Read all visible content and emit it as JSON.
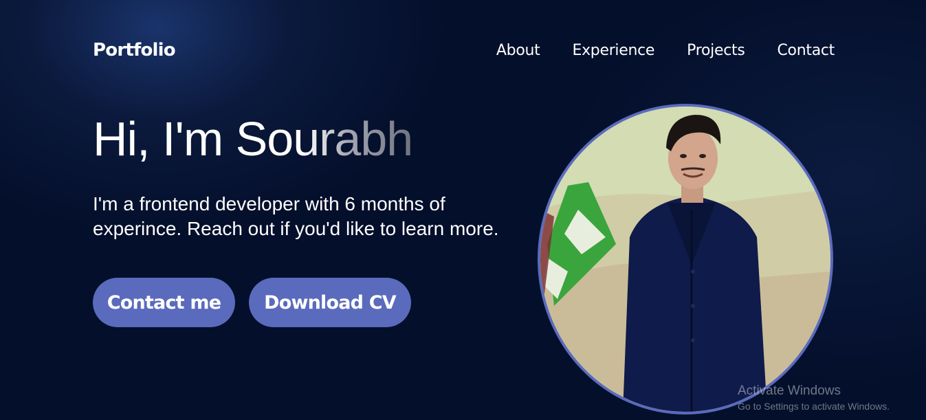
{
  "nav": {
    "logo": "Portfolio",
    "links": [
      "About",
      "Experience",
      "Projects",
      "Contact"
    ]
  },
  "hero": {
    "title": "Hi, I'm Sourabh",
    "subtitle": "I'm a frontend developer with 6 months of experince. Reach out if you'd like to learn more.",
    "buttons": {
      "contact": "Contact me",
      "cv": "Download CV"
    },
    "avatar_icon": "profile-photo"
  },
  "watermark": {
    "title": "Activate Windows",
    "subtitle": "Go to Settings to activate Windows."
  },
  "colors": {
    "background": "#040f2b",
    "accent": "#5a6bbd",
    "text": "#ffffff"
  }
}
